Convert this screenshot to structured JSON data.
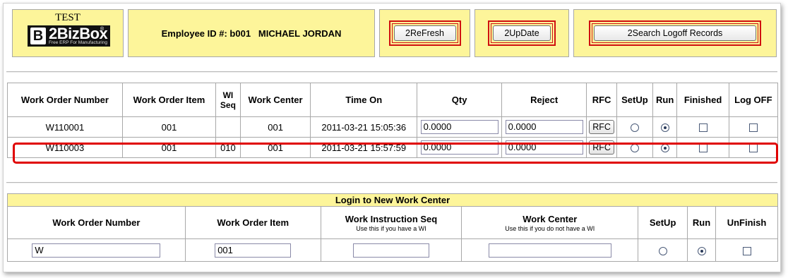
{
  "header": {
    "test_label": "TEST",
    "logo": {
      "mark": "B",
      "name": "2BizBox",
      "reg": "®",
      "tagline": "Free ERP For Manufacturing"
    },
    "employee_label": "Employee ID #: b001   MICHAEL JORDAN",
    "refresh_label": "2ReFresh",
    "update_label": "2UpDate",
    "search_label": "2Search Logoff Records"
  },
  "orders": {
    "headers": [
      "Work Order Number",
      "Work Order Item",
      "WI Seq",
      "Work Center",
      "Time On",
      "Qty",
      "Reject",
      "RFC",
      "SetUp",
      "Run",
      "Finished",
      "Log OFF"
    ],
    "rows": [
      {
        "wo": "W110001",
        "item": "001",
        "wiseq": "",
        "center": "001",
        "time_on": "2011-03-21 15:05:36",
        "qty": "0.0000",
        "reject": "0.0000",
        "rfc": "RFC",
        "setup": false,
        "run": true,
        "finished": false,
        "logoff": false
      },
      {
        "wo": "W110003",
        "item": "001",
        "wiseq": "010",
        "center": "001",
        "time_on": "2011-03-21 15:57:59",
        "qty": "0.0000",
        "reject": "0.0000",
        "rfc": "RFC",
        "setup": false,
        "run": true,
        "finished": false,
        "logoff": false
      }
    ]
  },
  "login": {
    "title": "Login to New Work Center",
    "headers": {
      "wo": "Work Order Number",
      "item": "Work Order Item",
      "wiseq": "Work Instruction Seq",
      "wiseq_hint": "Use this if you have a WI",
      "center": "Work Center",
      "center_hint": "Use this if you do not have a WI",
      "setup": "SetUp",
      "run": "Run",
      "unfinish": "UnFinish"
    },
    "values": {
      "wo": "W",
      "item": "001",
      "wiseq": "",
      "center": "",
      "setup": false,
      "run": true,
      "unfinish": false
    }
  },
  "colors": {
    "header_bg": "#fdf59a",
    "accent_red": "#d01010"
  }
}
